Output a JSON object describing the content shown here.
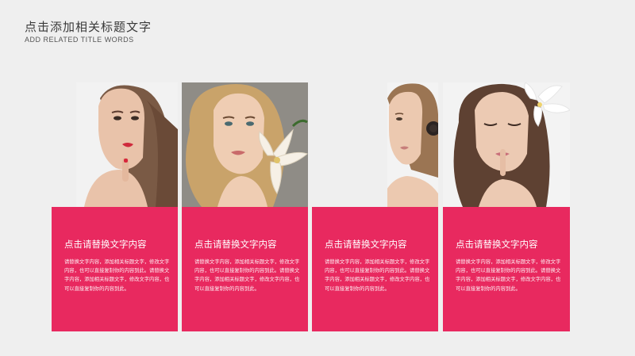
{
  "header": {
    "title": "点击添加相关标题文字",
    "subtitle": "ADD RELATED TITLE WORDS"
  },
  "cards": [
    {
      "title": "点击请替换文字内容",
      "body": "请替换文字内容，添加相关标题文字，修改文字内容，也可以直接复制你的内容到此。请替换文字内容，添加相关标题文字，修改文字内容，也可以直接复制你的内容到此。",
      "bg": "#e8295f"
    },
    {
      "title": "点击请替换文字内容",
      "body": "请替换文字内容，添加相关标题文字，修改文字内容，也可以直接复制你的内容到此。请替换文字内容，添加相关标题文字，修改文字内容，也可以直接复制你的内容到此。",
      "bg": "#e8295f"
    },
    {
      "title": "点击请替换文字内容",
      "body": "请替换文字内容，添加相关标题文字，修改文字内容，也可以直接复制你的内容到此。请替换文字内容，添加相关标题文字，修改文字内容，也可以直接复制你的内容到此。",
      "bg": "#e8295f"
    },
    {
      "title": "点击请替换文字内容",
      "body": "请替换文字内容，添加相关标题文字，修改文字内容，也可以直接复制你的内容到此。请替换文字内容，添加相关标题文字，修改文字内容，也可以直接复制你的内容到此。",
      "bg": "#e8295f"
    }
  ]
}
